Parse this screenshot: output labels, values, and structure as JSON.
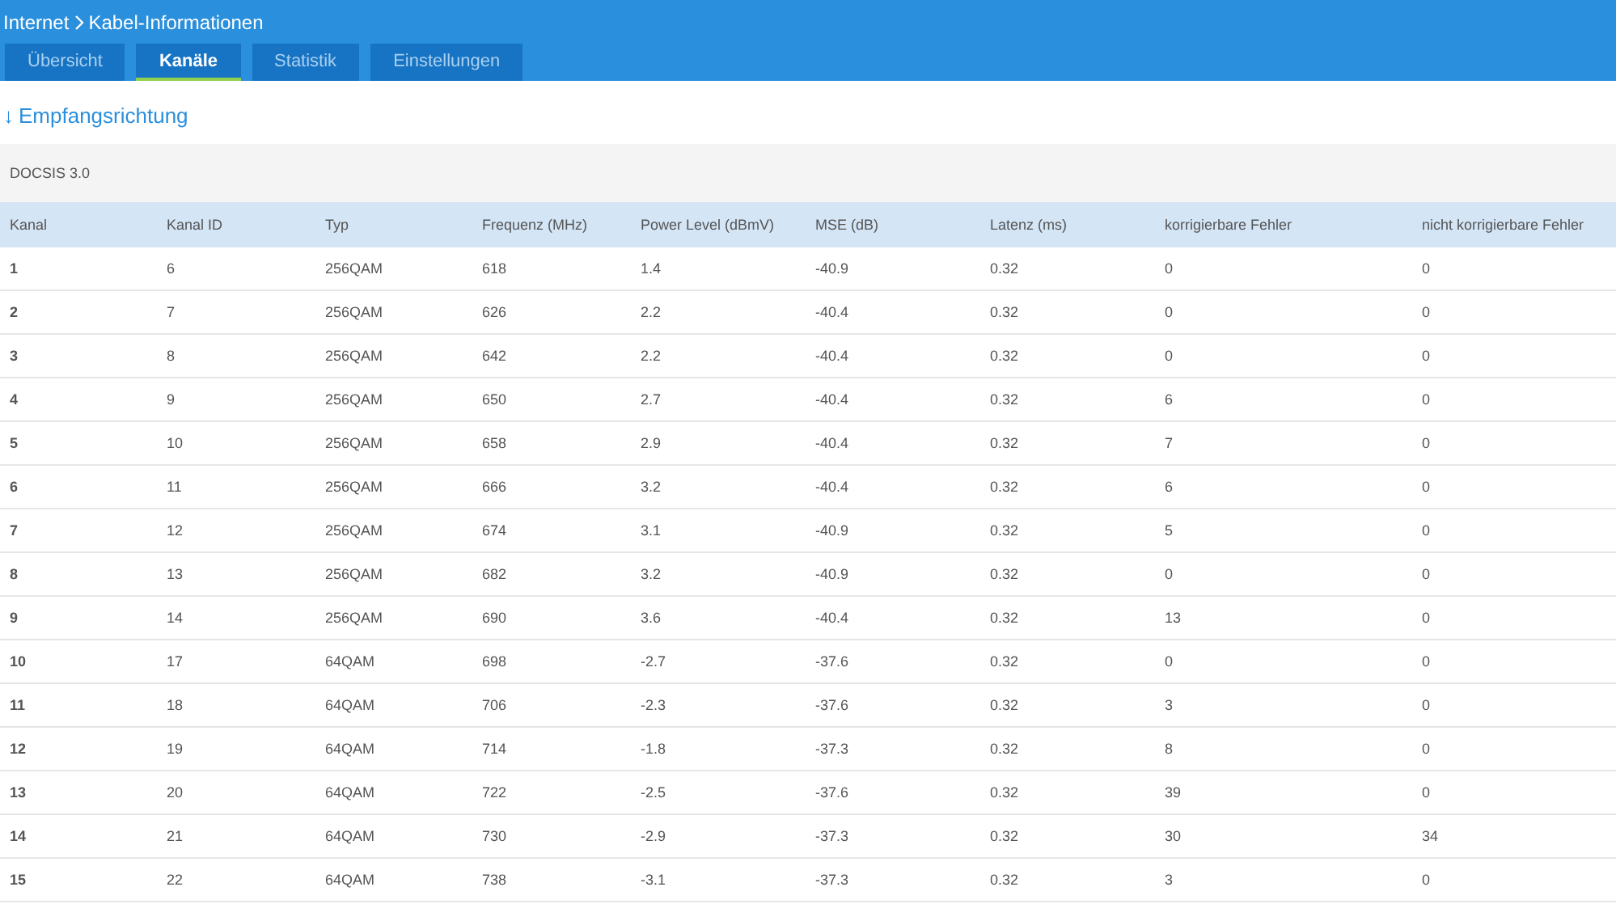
{
  "breadcrumb": {
    "parent": "Internet",
    "current": "Kabel-Informationen"
  },
  "tabs": [
    {
      "label": "Übersicht",
      "selected": false
    },
    {
      "label": "Kanäle",
      "selected": true
    },
    {
      "label": "Statistik",
      "selected": false
    },
    {
      "label": "Einstellungen",
      "selected": false
    }
  ],
  "section": {
    "arrow": "↓",
    "title": "Empfangsrichtung"
  },
  "table": {
    "caption": "DOCSIS 3.0",
    "columns": [
      "Kanal",
      "Kanal ID",
      "Typ",
      "Frequenz (MHz)",
      "Power Level (dBmV)",
      "MSE (dB)",
      "Latenz (ms)",
      "korrigierbare Fehler",
      "nicht korrigierbare Fehler"
    ],
    "rows": [
      [
        "1",
        "6",
        "256QAM",
        "618",
        "1.4",
        "-40.9",
        "0.32",
        "0",
        "0"
      ],
      [
        "2",
        "7",
        "256QAM",
        "626",
        "2.2",
        "-40.4",
        "0.32",
        "0",
        "0"
      ],
      [
        "3",
        "8",
        "256QAM",
        "642",
        "2.2",
        "-40.4",
        "0.32",
        "0",
        "0"
      ],
      [
        "4",
        "9",
        "256QAM",
        "650",
        "2.7",
        "-40.4",
        "0.32",
        "6",
        "0"
      ],
      [
        "5",
        "10",
        "256QAM",
        "658",
        "2.9",
        "-40.4",
        "0.32",
        "7",
        "0"
      ],
      [
        "6",
        "11",
        "256QAM",
        "666",
        "3.2",
        "-40.4",
        "0.32",
        "6",
        "0"
      ],
      [
        "7",
        "12",
        "256QAM",
        "674",
        "3.1",
        "-40.9",
        "0.32",
        "5",
        "0"
      ],
      [
        "8",
        "13",
        "256QAM",
        "682",
        "3.2",
        "-40.9",
        "0.32",
        "0",
        "0"
      ],
      [
        "9",
        "14",
        "256QAM",
        "690",
        "3.6",
        "-40.4",
        "0.32",
        "13",
        "0"
      ],
      [
        "10",
        "17",
        "64QAM",
        "698",
        "-2.7",
        "-37.6",
        "0.32",
        "0",
        "0"
      ],
      [
        "11",
        "18",
        "64QAM",
        "706",
        "-2.3",
        "-37.6",
        "0.32",
        "3",
        "0"
      ],
      [
        "12",
        "19",
        "64QAM",
        "714",
        "-1.8",
        "-37.3",
        "0.32",
        "8",
        "0"
      ],
      [
        "13",
        "20",
        "64QAM",
        "722",
        "-2.5",
        "-37.6",
        "0.32",
        "39",
        "0"
      ],
      [
        "14",
        "21",
        "64QAM",
        "730",
        "-2.9",
        "-37.3",
        "0.32",
        "30",
        "34"
      ],
      [
        "15",
        "22",
        "64QAM",
        "738",
        "-3.1",
        "-37.3",
        "0.32",
        "3",
        "0"
      ]
    ]
  }
}
